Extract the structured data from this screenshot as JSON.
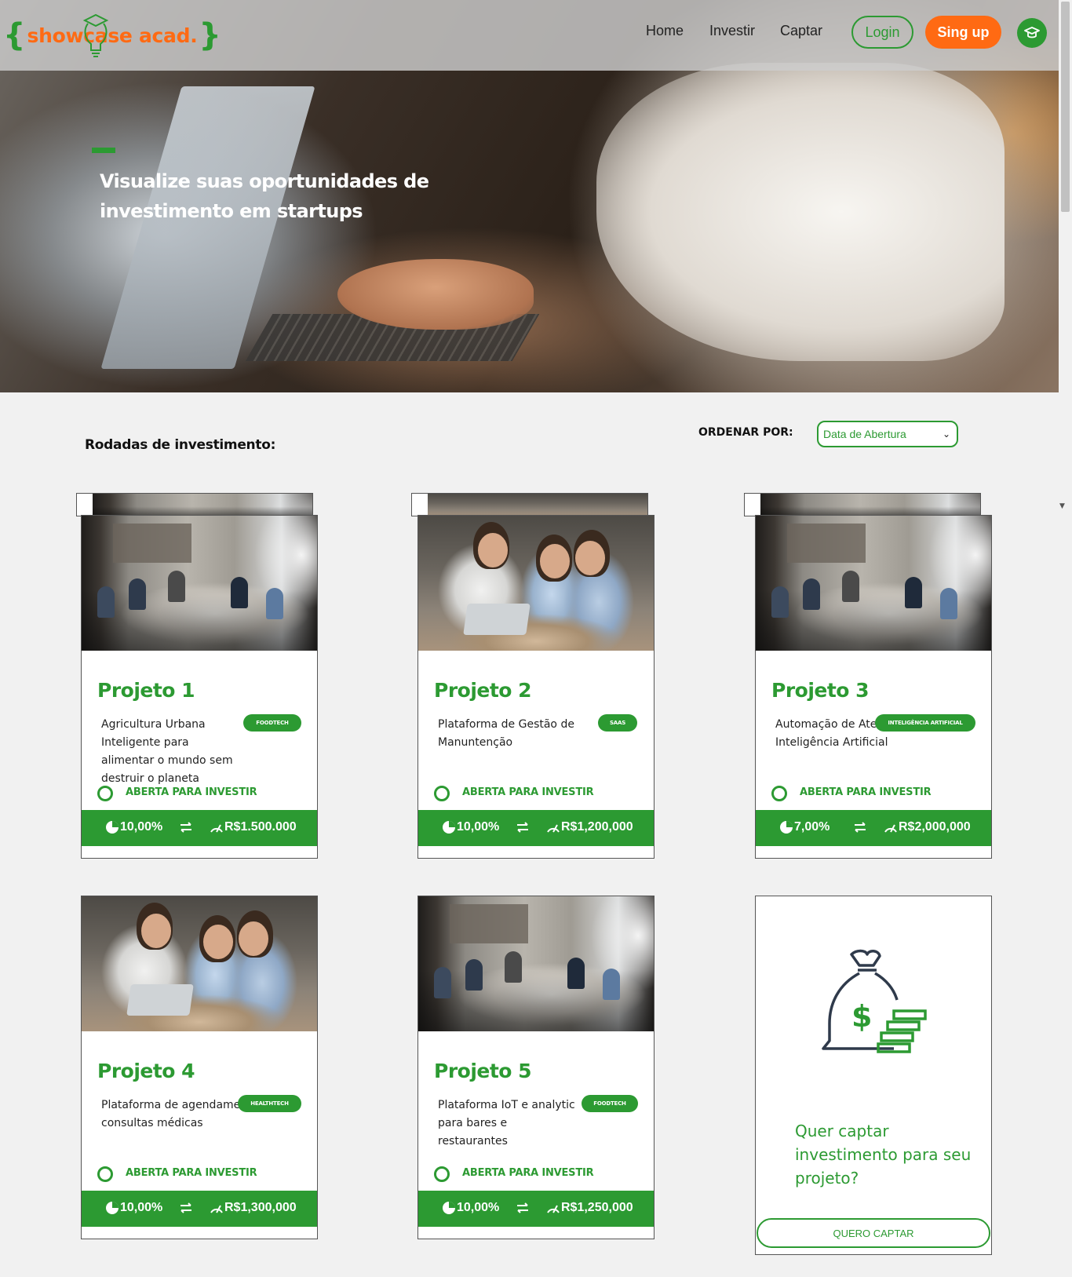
{
  "nav": {
    "logo": {
      "open": "{",
      "text": "showcase acad.",
      "close": "}"
    },
    "links": [
      "Home",
      "Investir",
      "Captar"
    ],
    "login_label": "Login",
    "signup_label": "Sing up",
    "profile_icon": "graduation-cap-icon"
  },
  "hero": {
    "title": "Visualize suas oportunidades de investimento em startups"
  },
  "section": {
    "title": "Rodadas de investimento:"
  },
  "sort": {
    "label": "ORDENAR POR:",
    "selected": "Data de Abertura"
  },
  "projects": [
    {
      "title": "Projeto 1",
      "description": "Agricultura Urbana Inteligente para alimentar o mundo sem destruir o planeta",
      "tag": "FOODTECH",
      "status": "ABERTA PARA INVESTIR",
      "rate": "10,00%",
      "amount": "R$1.500.000"
    },
    {
      "title": "Projeto 2",
      "description": "Plataforma de Gestão de Manuntenção",
      "tag": "SAAS",
      "status": "ABERTA PARA INVESTIR",
      "rate": "10,00%",
      "amount": "R$1,200,000"
    },
    {
      "title": "Projeto 3",
      "description": "Automação de Atendimento com Inteligência Artificial",
      "tag": "INTELIGÊNCIA ARTIFICIAL",
      "status": "ABERTA PARA INVESTIR",
      "rate": "7,00%",
      "amount": "R$2,000,000"
    },
    {
      "title": "Projeto 4",
      "description": "Plataforma de agendamento de consultas médicas",
      "tag": "HEALTHTECH",
      "status": "ABERTA PARA INVESTIR",
      "rate": "10,00%",
      "amount": "R$1,300,000"
    },
    {
      "title": "Projeto 5",
      "description": "Plataforma IoT e analytic para bares e restaurantes",
      "tag": "FOODTECH",
      "status": "ABERTA PARA INVESTIR",
      "rate": "10,00%",
      "amount": "R$1,250,000"
    }
  ],
  "cta": {
    "text": "Quer captar investimento para seu projeto?",
    "button": "QUERO CAPTAR"
  },
  "colors": {
    "accent": "#2c9a32",
    "brand_orange": "#ff6a13",
    "background": "#f1f1f1"
  },
  "icons": {
    "rate": "pie-chart-icon",
    "swap": "swap-arrows-icon",
    "amount": "speedometer-icon",
    "status": "circle-outline-icon",
    "cta": "money-bag-coins-icon"
  }
}
